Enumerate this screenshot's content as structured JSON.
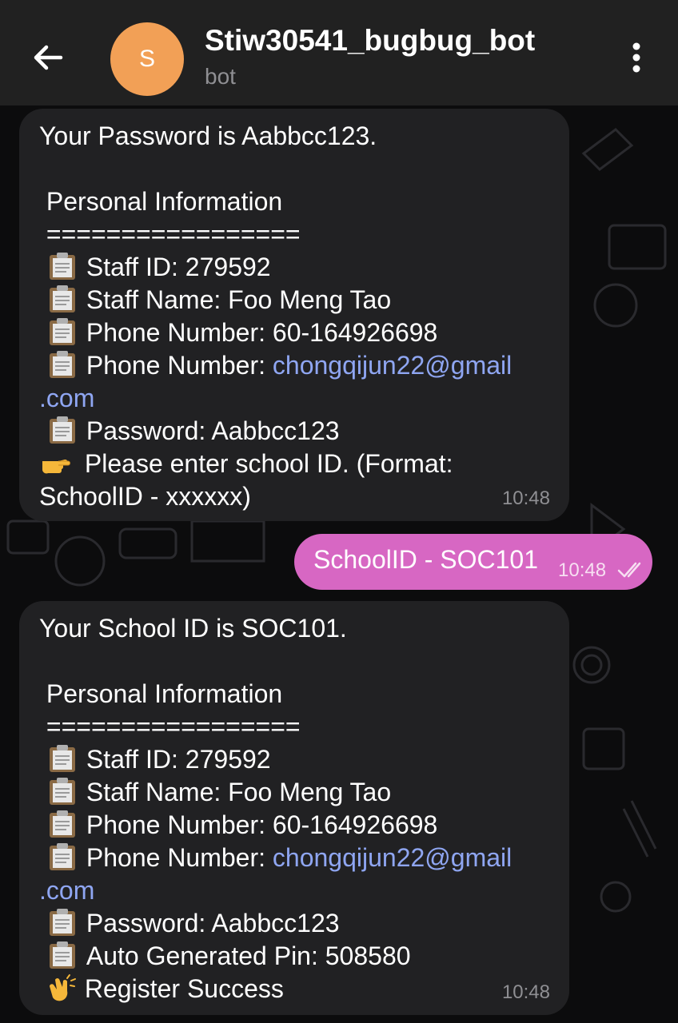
{
  "header": {
    "avatar_letter": "S",
    "title": "Stiw30541_bugbug_bot",
    "subtitle": "bot",
    "back_icon": "arrow-left-icon",
    "menu_icon": "more-vertical-icon"
  },
  "messages": [
    {
      "first_line": "Your Password is Aabbcc123.",
      "section_title": " Personal Information",
      "separator": " =================",
      "staff_id": "Staff ID: 279592",
      "staff_name": "Staff Name: Foo Meng Tao",
      "phone": "Phone Number: 60-164926698",
      "email_label": "Phone Number: ",
      "email_part1": "chongqijun22@gmail",
      "email_part2": ".com",
      "password": "Password: Aabbcc123",
      "prompt_1": " Please enter school ID. (Format:",
      "prompt_2": "SchoolID - xxxxxx)",
      "time": "10:48"
    },
    {
      "text": "SchoolID - SOC101",
      "time": "10:48",
      "status_icon": "double-check-icon"
    },
    {
      "first_line": "Your School ID is SOC101.",
      "section_title": " Personal Information",
      "separator": " =================",
      "staff_id": "Staff ID: 279592",
      "staff_name": "Staff Name: Foo Meng Tao",
      "phone": "Phone Number: 60-164926698",
      "email_label": "Phone Number: ",
      "email_part1": "chongqijun22@gmail",
      "email_part2": ".com",
      "password": "Password: Aabbcc123",
      "pin": "Auto Generated Pin: 508580",
      "success": "Register Success",
      "time": "10:48"
    }
  ],
  "colors": {
    "header_bg": "#212121",
    "incoming_bubble": "#212123",
    "outgoing_bubble": "#d767c3",
    "avatar": "#f2a056",
    "link": "#8fa6f2"
  }
}
